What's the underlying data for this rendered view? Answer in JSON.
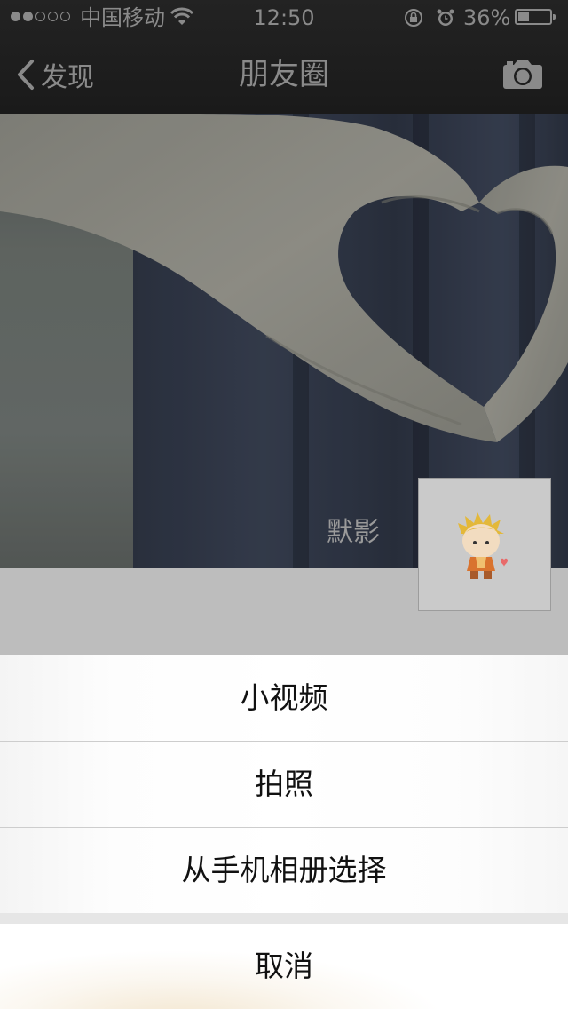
{
  "status_bar": {
    "carrier": "中国移动",
    "time": "12:50",
    "battery_percent": "36%",
    "battery_level": 0.36,
    "signal_bars_filled": 2,
    "signal_bars_total": 5
  },
  "nav": {
    "back_label": "发现",
    "title": "朋友圈",
    "back_icon": "chevron-left-icon",
    "camera_icon": "camera-icon"
  },
  "cover": {
    "username": "默影"
  },
  "action_sheet": {
    "items": [
      {
        "label": "小视频"
      },
      {
        "label": "拍照"
      },
      {
        "label": "从手机相册选择"
      }
    ],
    "cancel_label": "取消"
  },
  "colors": {
    "header_bg": "#1c1c1c",
    "header_text": "#8a8a8a",
    "sheet_bg": "#ffffff",
    "sheet_text": "#111111"
  }
}
